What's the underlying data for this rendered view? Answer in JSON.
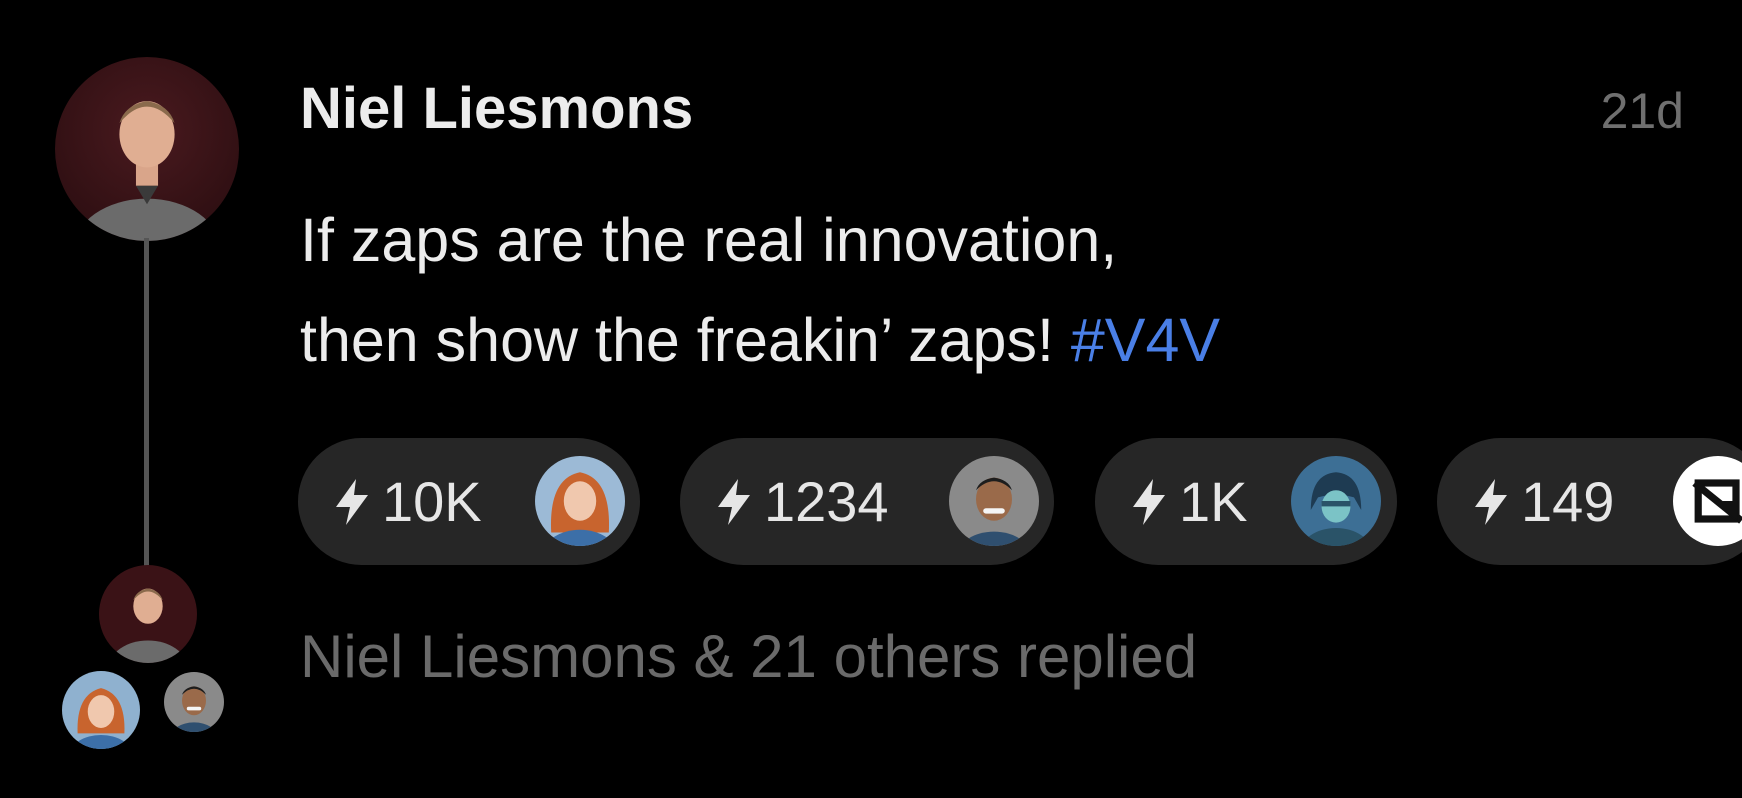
{
  "post": {
    "author": "Niel Liesmons",
    "timestamp": "21d",
    "body_line1": "If zaps are the real innovation,",
    "body_line2_text": "then show the freakin’ zaps! ",
    "hashtag": "#V4V"
  },
  "zaps": [
    {
      "amount": "10K",
      "avatar": "redhead-woman-avatar"
    },
    {
      "amount": "1234",
      "avatar": "smiling-man-avatar"
    },
    {
      "amount": "1K",
      "avatar": "hooded-figure-avatar"
    },
    {
      "amount": "149",
      "avatar": "logo-avatar"
    }
  ],
  "replies": {
    "summary": "Niel Liesmons & 21 others replied"
  },
  "colors": {
    "background": "#000000",
    "hashtag": "#4a7fe6",
    "pill": "#262626",
    "muted": "#6a6a6a",
    "thread_line": "#555555"
  },
  "icons": {
    "zap": "lightning-bolt-icon"
  }
}
